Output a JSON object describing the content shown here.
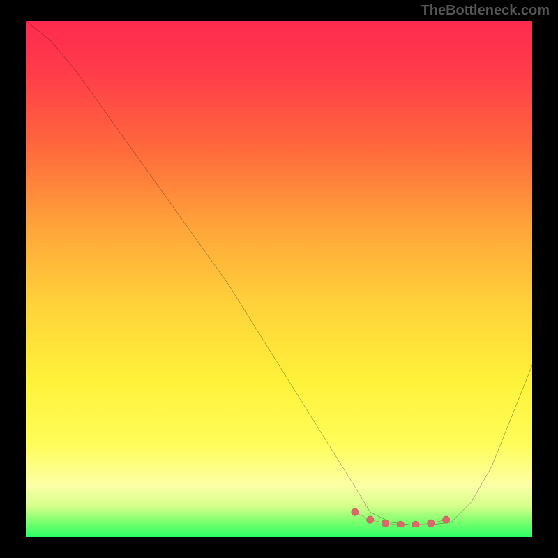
{
  "watermark": "TheBottleneck.com",
  "chart_data": {
    "type": "line",
    "title": "",
    "xlabel": "",
    "ylabel": "",
    "xlim": [
      0,
      100
    ],
    "ylim": [
      0,
      100
    ],
    "gradient_stops": [
      {
        "pos": 0,
        "color": "#ff2a4f"
      },
      {
        "pos": 10,
        "color": "#ff3c4a"
      },
      {
        "pos": 25,
        "color": "#ff6a3c"
      },
      {
        "pos": 40,
        "color": "#ffa53a"
      },
      {
        "pos": 55,
        "color": "#ffd23a"
      },
      {
        "pos": 70,
        "color": "#fff23a"
      },
      {
        "pos": 82,
        "color": "#fffd5a"
      },
      {
        "pos": 90,
        "color": "#fcffa6"
      },
      {
        "pos": 94,
        "color": "#d6ff8c"
      },
      {
        "pos": 97,
        "color": "#7dff6e"
      },
      {
        "pos": 100,
        "color": "#2bff66"
      }
    ],
    "series": [
      {
        "name": "bottleneck-curve",
        "x": [
          0,
          5,
          10,
          15,
          20,
          25,
          30,
          35,
          40,
          45,
          50,
          55,
          60,
          65,
          68,
          72,
          76,
          80,
          84,
          88,
          92,
          96,
          100
        ],
        "y": [
          100,
          96,
          90,
          83,
          76,
          69,
          62,
          55,
          48,
          40,
          32,
          24,
          16,
          8,
          3,
          1,
          0.5,
          0.5,
          1,
          5,
          12,
          22,
          32
        ]
      }
    ],
    "optimal_zone": {
      "x": [
        65,
        68,
        71,
        74,
        77,
        80,
        83
      ],
      "y": [
        3,
        1.5,
        0.8,
        0.5,
        0.5,
        0.8,
        1.5
      ]
    }
  }
}
